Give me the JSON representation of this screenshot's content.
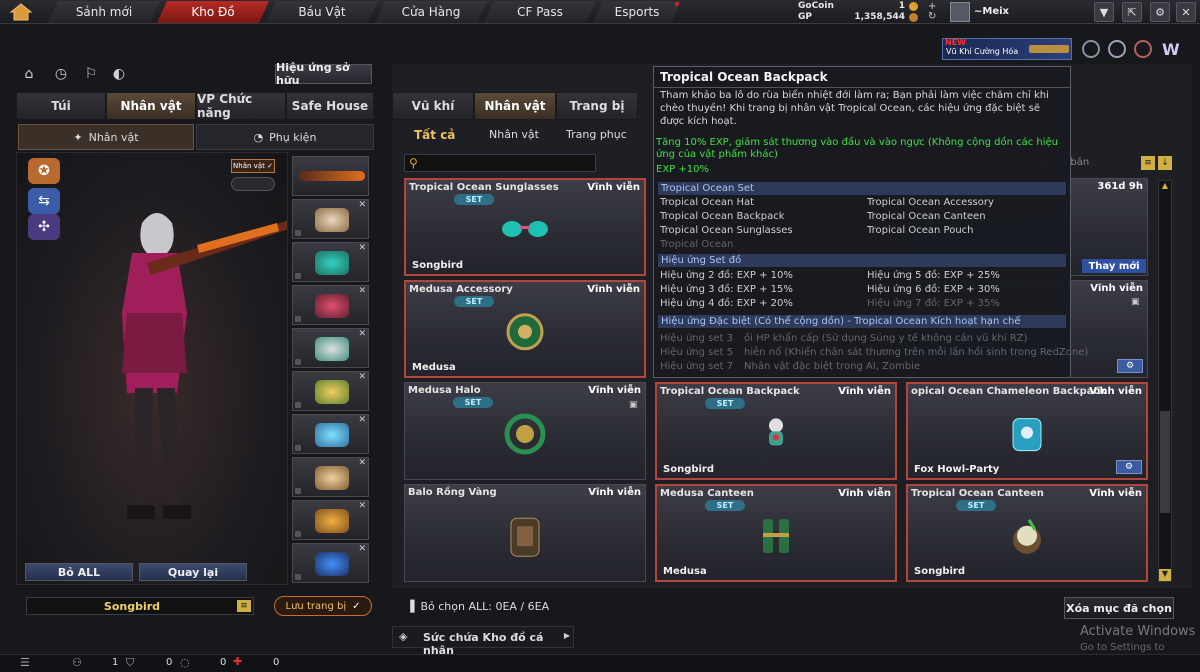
{
  "topnav": {
    "tabs": [
      "Sảnh mới",
      "Kho Đồ",
      "Báu Vật",
      "Cửa Hàng",
      "CF Pass",
      "Esports"
    ],
    "active": "Kho Đồ"
  },
  "currency": {
    "gocoin_label": "GoCoin",
    "gocoin_value": "1",
    "gp_label": "GP",
    "gp_value": "1,358,544"
  },
  "player": {
    "name": "~Meix"
  },
  "promo": {
    "badge": "NEW",
    "text": "Vũ Khí Cường Hóa"
  },
  "left": {
    "effect_button": "Hiệu ứng sở hữu",
    "tabs": [
      "Túi",
      "Nhân vật",
      "VP Chức năng",
      "Safe House"
    ],
    "subtabs": [
      "Nhân vật",
      "Phụ kiện"
    ],
    "char_badge": "Nhân vật ✓",
    "buttons": {
      "clear_all": "Bỏ ALL",
      "back": "Quay lại"
    },
    "preset_name": "Songbird",
    "save_button": "Lưu trang bị"
  },
  "main": {
    "tabs": [
      "Vũ khí",
      "Nhân vật",
      "Trang bị"
    ],
    "subtabs": [
      "Tất cả",
      "Nhân vật",
      "Trang phục"
    ],
    "search_placeholder": "",
    "sort_label": "Sắp xếp cơ bản",
    "cards": [
      {
        "name": "Tropical Ocean Sunglasses",
        "perm": "Vĩnh viễn",
        "set": "SET",
        "owner": "Songbird"
      },
      {
        "name": "Medusa Accessory",
        "perm": "Vĩnh viễn",
        "set": "SET",
        "owner": "Medusa"
      },
      {
        "name": "Medusa Halo",
        "perm": "Vĩnh viễn",
        "set": "SET",
        "owner": ""
      },
      {
        "name": "Tropical Ocean Backpack",
        "perm": "Vĩnh viễn",
        "set": "SET",
        "owner": "Songbird"
      },
      {
        "name": "opical Ocean Chameleon Backpack",
        "perm": "Vĩnh viễn",
        "set": "",
        "owner": "Fox Howl-Party"
      },
      {
        "name": "Balo Rồng Vàng",
        "perm": "Vĩnh viễn",
        "set": "",
        "owner": ""
      },
      {
        "name": "Medusa Canteen",
        "perm": "Vĩnh viễn",
        "set": "SET",
        "owner": "Medusa"
      },
      {
        "name": "Tropical Ocean Canteen",
        "perm": "Vĩnh viễn",
        "set": "SET",
        "owner": "Songbird"
      }
    ],
    "hidden_card": {
      "time": "361d 9h",
      "change": "Thay mới",
      "perm": "Vĩnh viễn"
    },
    "selected_count": "Bỏ chọn ALL: 0EA / 6EA",
    "clear_selection_button": "Xóa mục đã chọn",
    "repair_label": "Sức chứa Kho đồ cá nhân"
  },
  "tooltip": {
    "title": "Tropical Ocean Backpack",
    "desc": "Tham khảo ba lô do rùa biển nhiệt đới làm ra; Bạn phải làm việc chăm chỉ khi chèo thuyền! Khi trang bị nhân vật Tropical Ocean, các hiệu ứng đặc biệt sẽ được kích hoạt.",
    "bonus1": "Tăng 10% EXP, giảm sát thương vào đầu và vào ngực (Không cộng dồn các hiệu ứng của vật phẩm khác)",
    "bonus2": "EXP +10%",
    "set_header": "Tropical Ocean Set",
    "set_items": [
      "Tropical Ocean Hat",
      "Tropical Ocean Accessory",
      "Tropical Ocean Backpack",
      "Tropical Ocean Canteen",
      "Tropical Ocean Sunglasses",
      "Tropical Ocean Pouch",
      "Tropical Ocean"
    ],
    "set_effect_header": "Hiệu ứng Set đồ",
    "set_effects": [
      "Hiệu ứng 2 đồ: EXP + 10%",
      "Hiệu ứng 5 đồ: EXP + 25%",
      "Hiệu ứng 3 đồ: EXP + 15%",
      "Hiệu ứng 6 đồ: EXP + 30%",
      "Hiệu ứng 4 đồ: EXP + 20%",
      "Hiệu ứng 7 đồ: EXP + 35%"
    ],
    "special_header": "Hiệu ứng Đặc biệt (Có thể cộng dồn) - Tropical Ocean Kích hoạt hạn chế",
    "special": [
      {
        "k": "Hiệu ứng set 3",
        "v": "ồi HP khẩn cấp (Sử dụng Súng y tế không cần vũ khí RZ)"
      },
      {
        "k": "Hiệu ứng set 5",
        "v": "hiễn nổ (Khiến chân sát thương trên mỗi lần hồi sinh trong RedZone)"
      },
      {
        "k": "Hiệu ứng set 7",
        "v": "Nhân vật đặc biệt trong AI, Zombie"
      }
    ]
  },
  "bottom": {
    "count1": "1",
    "count2": "0",
    "count3": "0",
    "count4": "0"
  },
  "watermark": {
    "line1": "Activate Windows",
    "line2": "Go to Settings to activate"
  }
}
